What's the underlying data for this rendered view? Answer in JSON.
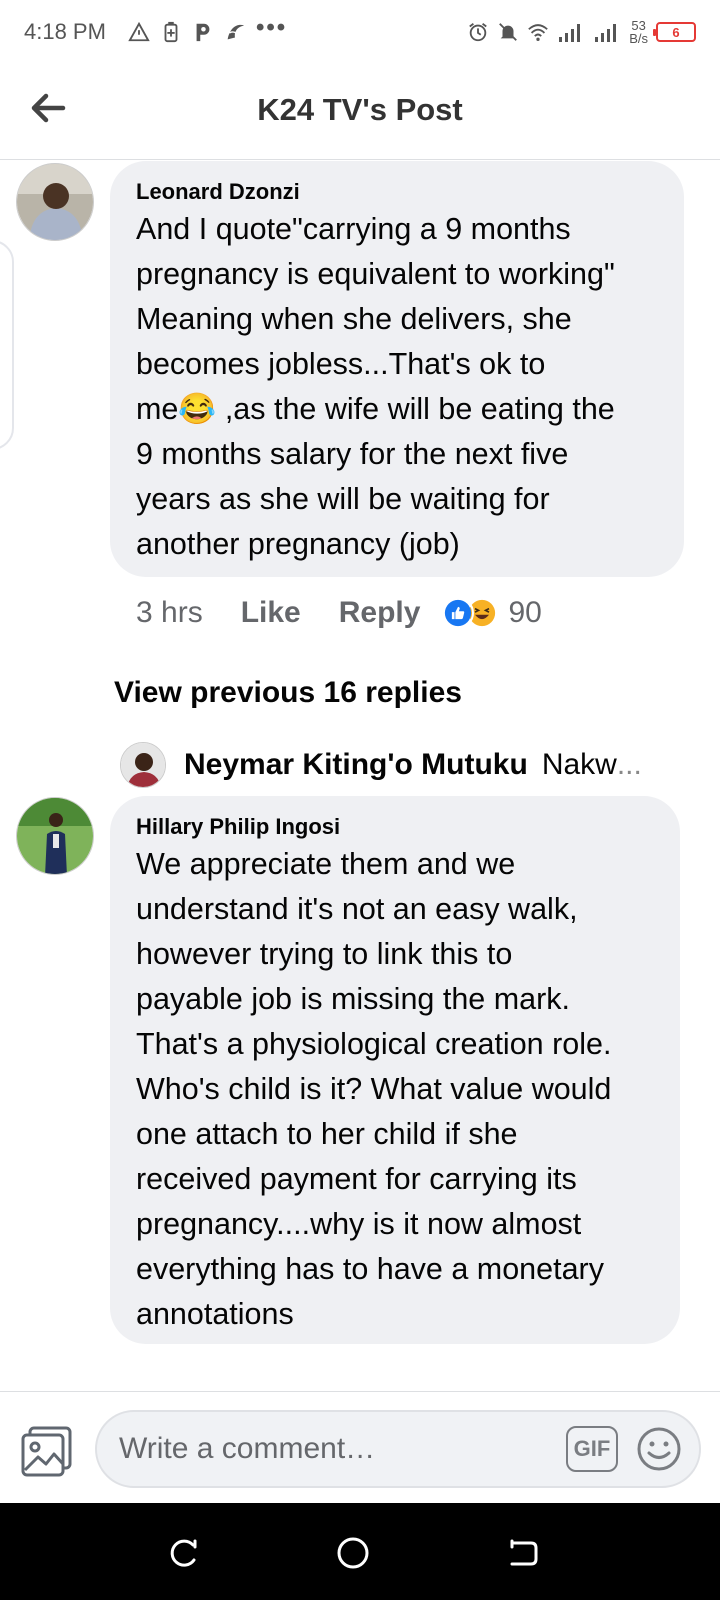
{
  "status_bar": {
    "time": "4:18 PM",
    "net_speed_value": "53",
    "net_speed_unit": "B/s",
    "battery_level": "6",
    "icons": [
      "warning-icon",
      "battery-saver-icon",
      "p-app-icon",
      "app-icon",
      "more-dots-icon",
      "alarm-icon",
      "mute-icon",
      "wifi-icon",
      "signal-icon",
      "signal-icon",
      "battery-icon"
    ],
    "more_dots": "•••"
  },
  "header": {
    "title": "K24 TV's Post"
  },
  "comments": [
    {
      "author": "Leonard Dzonzi",
      "lines": [
        "And I quote\"carrying a 9 months",
        "pregnancy is equivalent to working\"",
        "Meaning when she delivers, she",
        "becomes jobless...That's ok to",
        "me😂 ,as the wife will be eating the",
        "9 months salary for the next five",
        "years as she will be waiting for",
        "another pregnancy (job)"
      ],
      "time": "3 hrs",
      "like_label": "Like",
      "reply_label": "Reply",
      "reaction_count": "90",
      "reactions": [
        "like-reaction-icon",
        "haha-reaction-icon"
      ]
    },
    {
      "author": "Hillary Philip Ingosi",
      "lines": [
        "We appreciate them and we",
        "understand it's not an easy walk,",
        "however trying to link this to",
        "payable job is missing the mark.",
        "That's a physiological creation role.",
        "Who's child is it? What value would",
        "one attach to her child if she",
        "received payment for carrying its",
        "pregnancy....why is it now almost",
        "everything has to have a monetary",
        "annotations"
      ]
    }
  ],
  "replies": {
    "view_previous_label": "View previous 16 replies",
    "latest_name": "Neymar Kiting'o Mutuku",
    "latest_snippet": "Nakw",
    "ellipsis": "..."
  },
  "composer": {
    "placeholder": "Write a comment…",
    "gif_label": "GIF"
  },
  "colors": {
    "bubble": "#eff0f3",
    "like_blue": "#1877f2",
    "haha_yellow": "#f7b125",
    "battery_red": "#e53935"
  }
}
